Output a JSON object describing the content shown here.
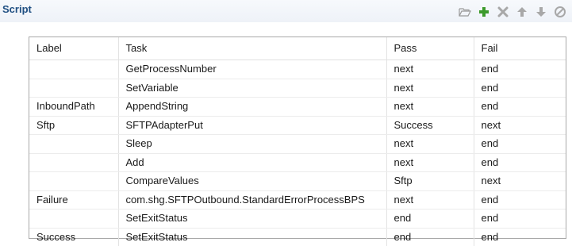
{
  "panel": {
    "title": "Script"
  },
  "toolbar": {
    "buttons": [
      {
        "icon": "folder-open-icon"
      },
      {
        "icon": "add-icon",
        "color": "#3c9a2c"
      },
      {
        "icon": "delete-icon",
        "color": "#a8a8a8"
      },
      {
        "icon": "move-up-icon",
        "color": "#a8a8a8"
      },
      {
        "icon": "move-down-icon",
        "color": "#a8a8a8"
      },
      {
        "icon": "disable-icon",
        "color": "#a8a8a8"
      }
    ]
  },
  "table": {
    "columns": [
      "Label",
      "Task",
      "Pass",
      "Fail"
    ],
    "rows": [
      {
        "label": "",
        "task": "GetProcessNumber",
        "pass": "next",
        "fail": "end"
      },
      {
        "label": "",
        "task": "SetVariable",
        "pass": "next",
        "fail": "end"
      },
      {
        "label": "InboundPath",
        "task": "AppendString",
        "pass": "next",
        "fail": "end"
      },
      {
        "label": "Sftp",
        "task": "SFTPAdapterPut",
        "pass": "Success",
        "fail": "next"
      },
      {
        "label": "",
        "task": "Sleep",
        "pass": "next",
        "fail": "end"
      },
      {
        "label": "",
        "task": "Add",
        "pass": "next",
        "fail": "end"
      },
      {
        "label": "",
        "task": "CompareValues",
        "pass": "Sftp",
        "fail": "next"
      },
      {
        "label": "Failure",
        "task": "com.shg.SFTPOutbound.StandardErrorProcessBPS",
        "pass": "next",
        "fail": "end"
      },
      {
        "label": "",
        "task": "SetExitStatus",
        "pass": "end",
        "fail": "end"
      },
      {
        "label": "Success",
        "task": "SetExitStatus",
        "pass": "end",
        "fail": "end"
      }
    ]
  }
}
